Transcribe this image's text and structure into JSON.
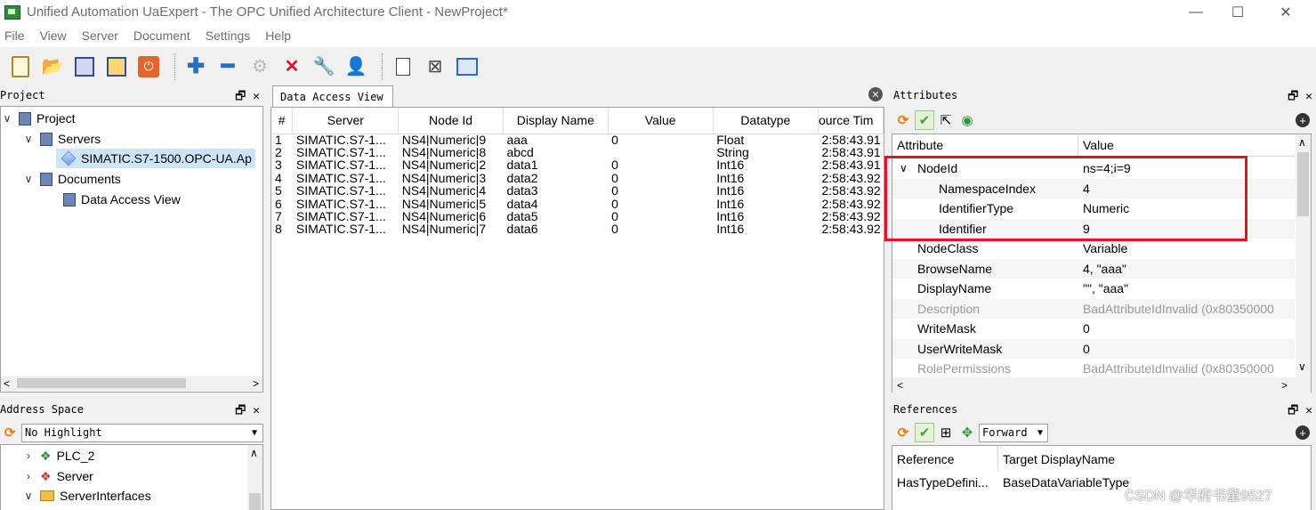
{
  "window": {
    "title": "Unified Automation UaExpert - The OPC Unified Architecture Client - NewProject*",
    "controls": [
      "—",
      "☐",
      "✕"
    ]
  },
  "menu": [
    "File",
    "View",
    "Server",
    "Document",
    "Settings",
    "Help"
  ],
  "project_panel": {
    "title": "Project",
    "tree": {
      "root": "Project",
      "servers": "Servers",
      "server_item": "SIMATIC.S7-1500.OPC-UA.Ap",
      "documents": "Documents",
      "doc_item": "Data Access View"
    }
  },
  "address_panel": {
    "title": "Address Space",
    "highlight_select": "No Highlight",
    "items": [
      "PLC_2",
      "Server",
      "ServerInterfaces"
    ]
  },
  "data_access": {
    "tab_label": "Data Access View",
    "columns": [
      "#",
      "Server",
      "Node Id",
      "Display Name",
      "Value",
      "Datatype",
      "ource Tim"
    ],
    "rows": [
      [
        "1",
        "SIMATIC.S7-1...",
        "NS4|Numeric|9",
        "aaa",
        "0",
        "Float",
        "2:58:43.91"
      ],
      [
        "2",
        "SIMATIC.S7-1...",
        "NS4|Numeric|8",
        "abcd",
        "",
        "String",
        "2:58:43.91"
      ],
      [
        "3",
        "SIMATIC.S7-1...",
        "NS4|Numeric|2",
        "data1",
        "0",
        "Int16",
        "2:58:43.91"
      ],
      [
        "4",
        "SIMATIC.S7-1...",
        "NS4|Numeric|3",
        "data2",
        "0",
        "Int16",
        "2:58:43.92"
      ],
      [
        "5",
        "SIMATIC.S7-1...",
        "NS4|Numeric|4",
        "data3",
        "0",
        "Int16",
        "2:58:43.92"
      ],
      [
        "6",
        "SIMATIC.S7-1...",
        "NS4|Numeric|5",
        "data4",
        "0",
        "Int16",
        "2:58:43.92"
      ],
      [
        "7",
        "SIMATIC.S7-1...",
        "NS4|Numeric|6",
        "data5",
        "0",
        "Int16",
        "2:58:43.92"
      ],
      [
        "8",
        "SIMATIC.S7-1...",
        "NS4|Numeric|7",
        "data6",
        "0",
        "Int16",
        "2:58:43.92"
      ]
    ]
  },
  "attributes_panel": {
    "title": "Attributes",
    "header_attribute": "Attribute",
    "header_value": "Value",
    "rows": [
      {
        "name": "NodeId",
        "value": "ns=4;i=9",
        "level": 0,
        "expanded": true,
        "dim": false
      },
      {
        "name": "NamespaceIndex",
        "value": "4",
        "level": 1,
        "dim": false
      },
      {
        "name": "IdentifierType",
        "value": "Numeric",
        "level": 1,
        "dim": false
      },
      {
        "name": "Identifier",
        "value": "9",
        "level": 1,
        "dim": false
      },
      {
        "name": "NodeClass",
        "value": "Variable",
        "level": 0,
        "dim": false
      },
      {
        "name": "BrowseName",
        "value": "4, \"aaa\"",
        "level": 0,
        "dim": false
      },
      {
        "name": "DisplayName",
        "value": "\"\", \"aaa\"",
        "level": 0,
        "dim": false
      },
      {
        "name": "Description",
        "value": "BadAttributeIdInvalid (0x80350000",
        "level": 0,
        "dim": true
      },
      {
        "name": "WriteMask",
        "value": "0",
        "level": 0,
        "dim": false
      },
      {
        "name": "UserWriteMask",
        "value": "0",
        "level": 0,
        "dim": false
      },
      {
        "name": "RolePermissions",
        "value": "BadAttributeIdInvalid (0x80350000",
        "level": 0,
        "dim": true
      }
    ]
  },
  "references_panel": {
    "title": "References",
    "direction": "Forward",
    "header_reference": "Reference",
    "header_target": "Target DisplayName",
    "row_reference": "HasTypeDefini...",
    "row_target": "BaseDataVariableType"
  },
  "watermark": "CSDN @华府书童9527"
}
